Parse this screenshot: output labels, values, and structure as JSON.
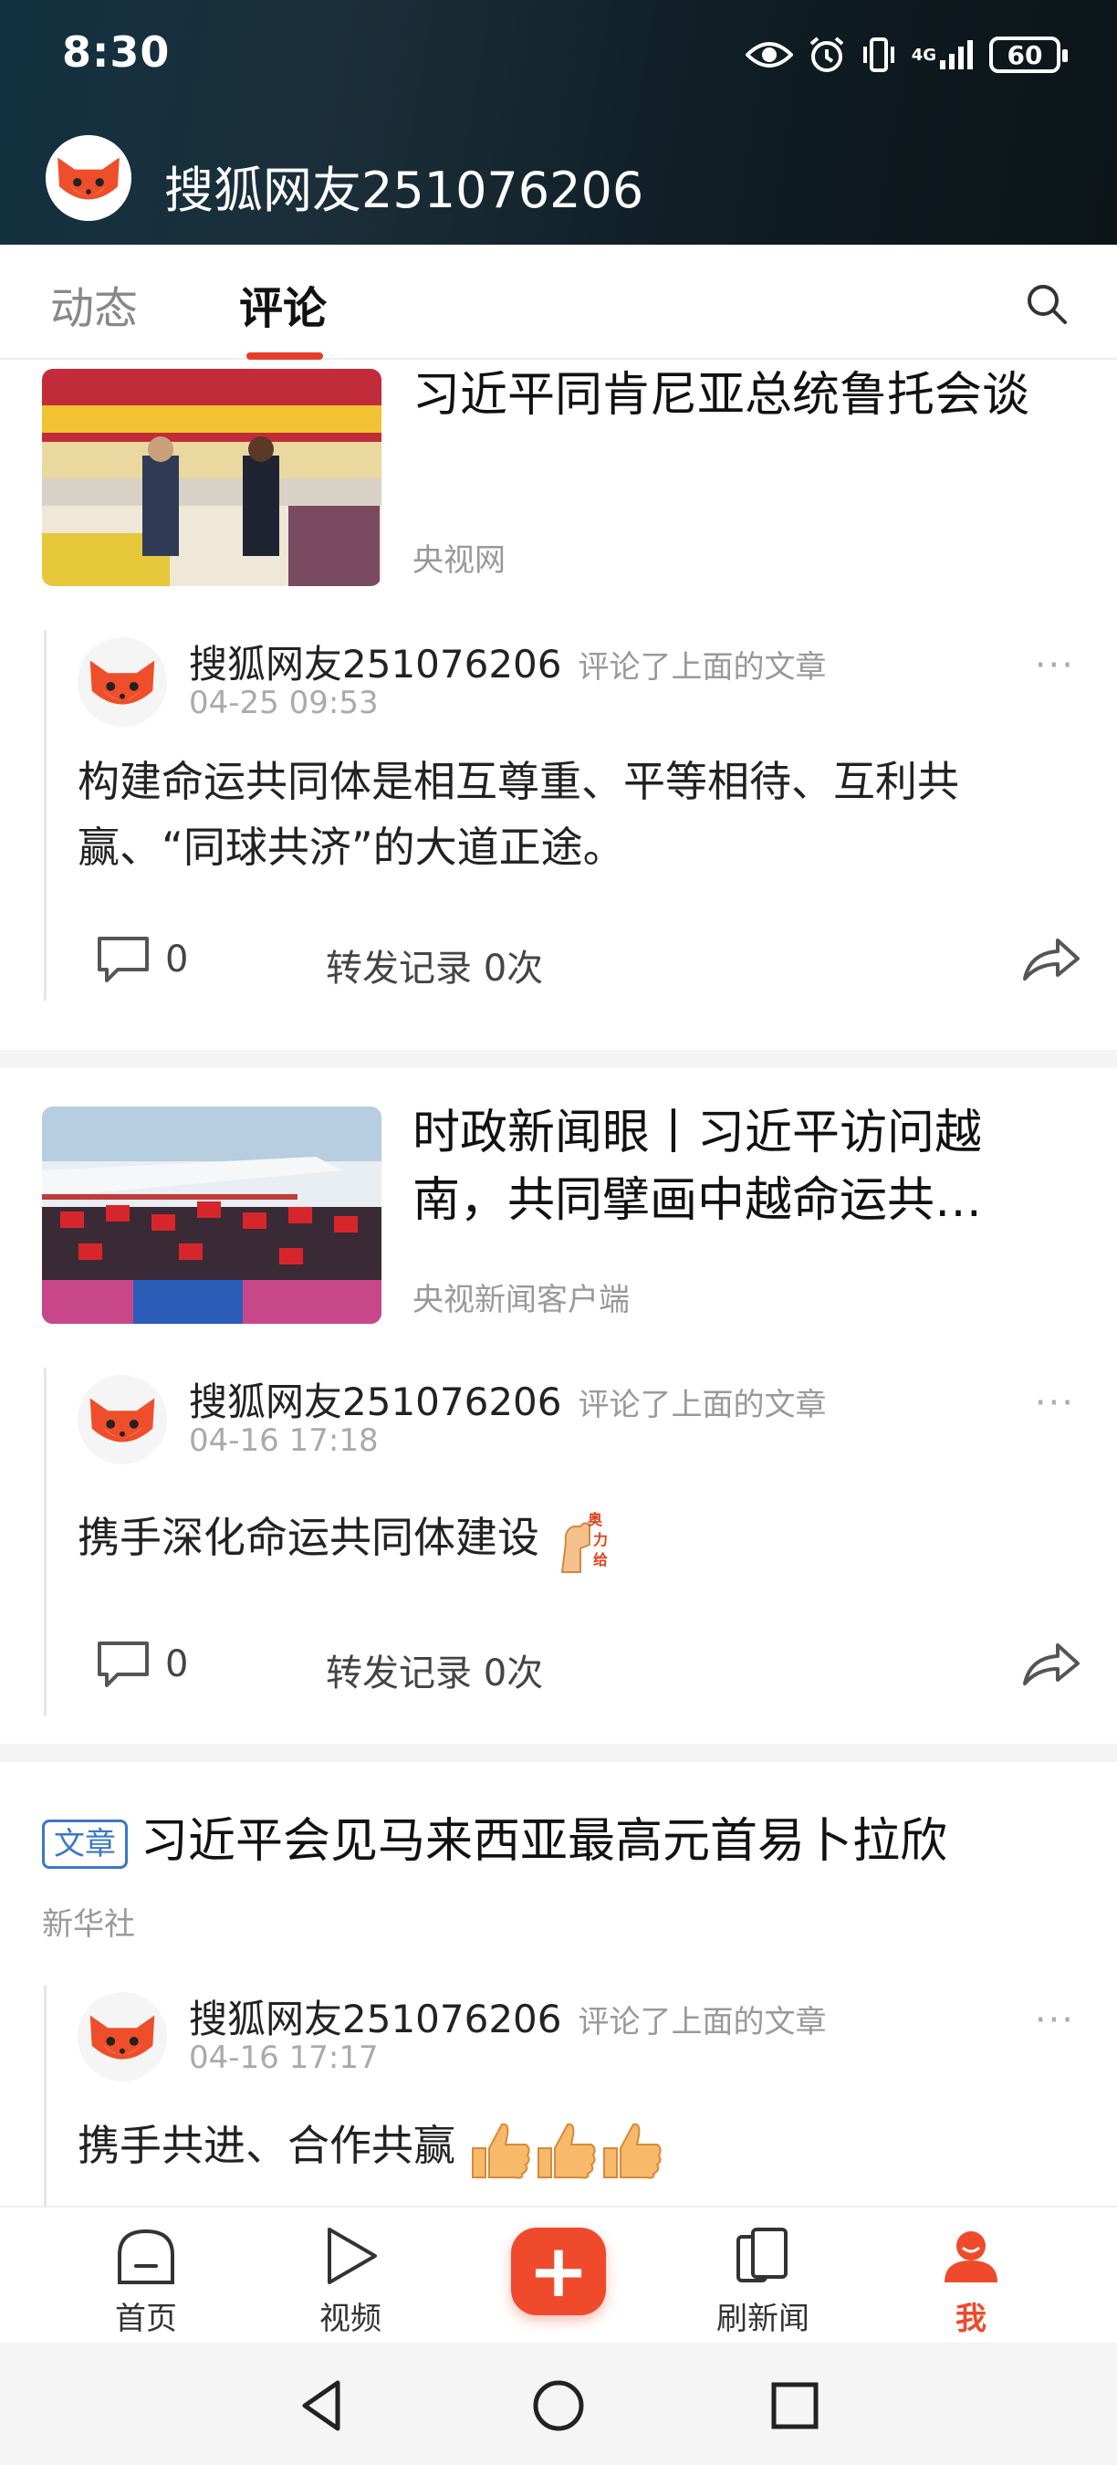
{
  "status_bar": {
    "time": "8:30",
    "network": "4G",
    "battery": "60"
  },
  "profile": {
    "username": "搜狐网友251076206"
  },
  "tabs": {
    "dynamic": "动态",
    "comments": "评论"
  },
  "feed": [
    {
      "type": "image_article",
      "title": "习近平同肯尼亚总统鲁托会谈",
      "source": "央视网",
      "comment": {
        "user": "搜狐网友251076206",
        "action": "评论了上面的文章",
        "time": "04-25 09:53",
        "text": "构建命运共同体是相互尊重、平等相待、互利共赢、“同球共济”的大道正途。",
        "reply_count": "0",
        "forward_record": "转发记录 0次"
      }
    },
    {
      "type": "image_article",
      "title": "时政新闻眼丨习近平访问越南，共同擘画中越命运共…",
      "source": "央视新闻客户端",
      "comment": {
        "user": "搜狐网友251076206",
        "action": "评论了上面的文章",
        "time": "04-16 17:18",
        "text": "携手深化命运共同体建设",
        "emoji_name": "fist-emoji",
        "reply_count": "0",
        "forward_record": "转发记录 0次"
      }
    },
    {
      "type": "text_article",
      "tag": "文章",
      "title": "习近平会见马来西亚最高元首易卜拉欣",
      "source": "新华社",
      "comment": {
        "user": "搜狐网友251076206",
        "action": "评论了上面的文章",
        "time": "04-16 17:17",
        "text": "携手共进、合作共赢",
        "emoji_name": "thumbs-up-emoji"
      }
    }
  ],
  "bottom_nav": {
    "home": "首页",
    "video": "视频",
    "news": "刷新闻",
    "me": "我"
  },
  "colors": {
    "accent": "#e53d2a",
    "tag_blue": "#3b78c4"
  }
}
